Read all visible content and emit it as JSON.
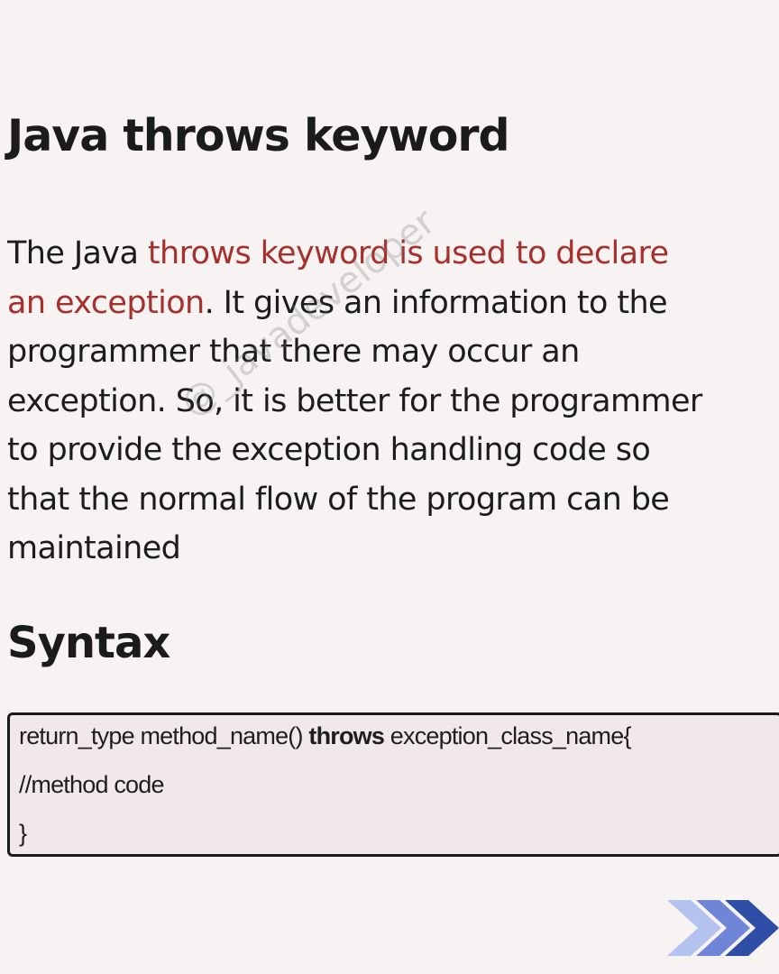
{
  "title": "Java throws keyword",
  "paragraph": {
    "line1_plain": "The Java ",
    "line1_highlight": "throws keyword is used to declare",
    "line2_highlight": "an exception",
    "line2_plain": ". It gives an information to the",
    "line3": "programmer that there may occur an",
    "line4": "exception. So, it is better for the programmer",
    "line5": "to provide the exception handling code so",
    "line6": "that the normal flow of the program can be",
    "line7": "maintained"
  },
  "watermark": "@_javadeveloper",
  "syntax_heading": "Syntax",
  "code": {
    "line1_before": "return_type method_name() ",
    "line1_keyword": "throws",
    "line1_after": " exception_class_name{",
    "line2": "//method code",
    "line3": "}"
  },
  "colors": {
    "background": "#f7f3f3",
    "text": "#1c1c1c",
    "highlight": "#a8302c",
    "code_background": "#f1e9e9",
    "arrow_light": "#b3c2ef",
    "arrow_mid": "#6f86d8",
    "arrow_dark": "#2f4ea8"
  },
  "icons": {
    "next": "chevron-right-triple-icon"
  }
}
